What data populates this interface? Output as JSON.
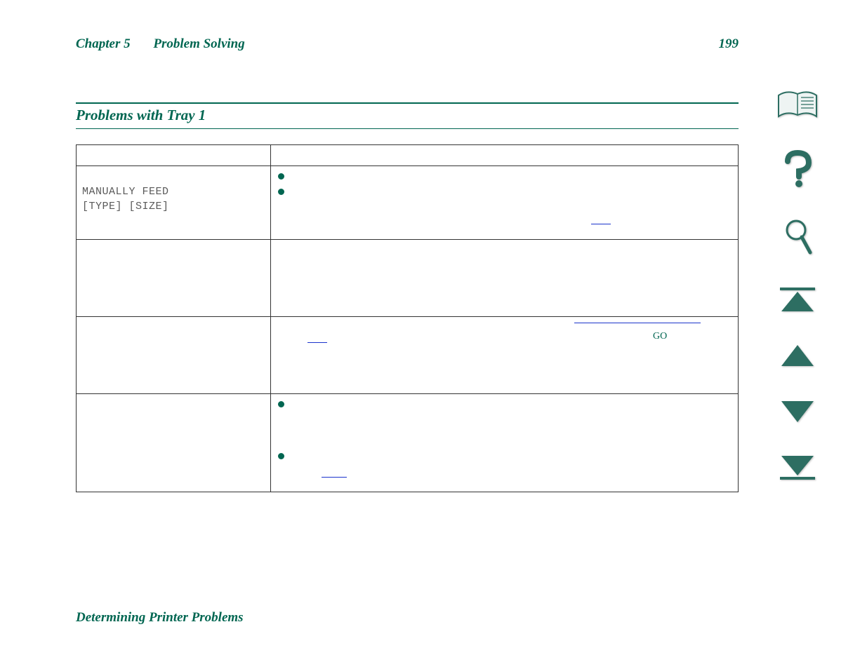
{
  "header": {
    "chapter": "Chapter 5",
    "chapter_title": "Problem Solving",
    "page_number": "199"
  },
  "section": {
    "title": "Problems with Tray 1"
  },
  "table": {
    "rows": [
      {
        "left_mono": "MANUALLY FEED\n[TYPE] [SIZE]",
        "right": {
          "bullets": [
            {
              "text": ""
            },
            {
              "text": ""
            }
          ]
        }
      },
      {
        "left_mono": "",
        "right": {
          "text": ""
        }
      },
      {
        "left_mono": "",
        "right": {
          "text_go": "GO"
        }
      },
      {
        "left_mono": "",
        "right": {
          "bullets": [
            {
              "text": ""
            },
            {
              "text": ""
            }
          ]
        }
      }
    ]
  },
  "footer": {
    "section_title": "Determining Printer Problems"
  },
  "nav": {
    "items": [
      {
        "name": "contents-icon"
      },
      {
        "name": "help-icon"
      },
      {
        "name": "search-icon"
      },
      {
        "name": "first-page-icon"
      },
      {
        "name": "previous-page-icon"
      },
      {
        "name": "next-page-icon"
      },
      {
        "name": "last-page-icon"
      }
    ]
  }
}
